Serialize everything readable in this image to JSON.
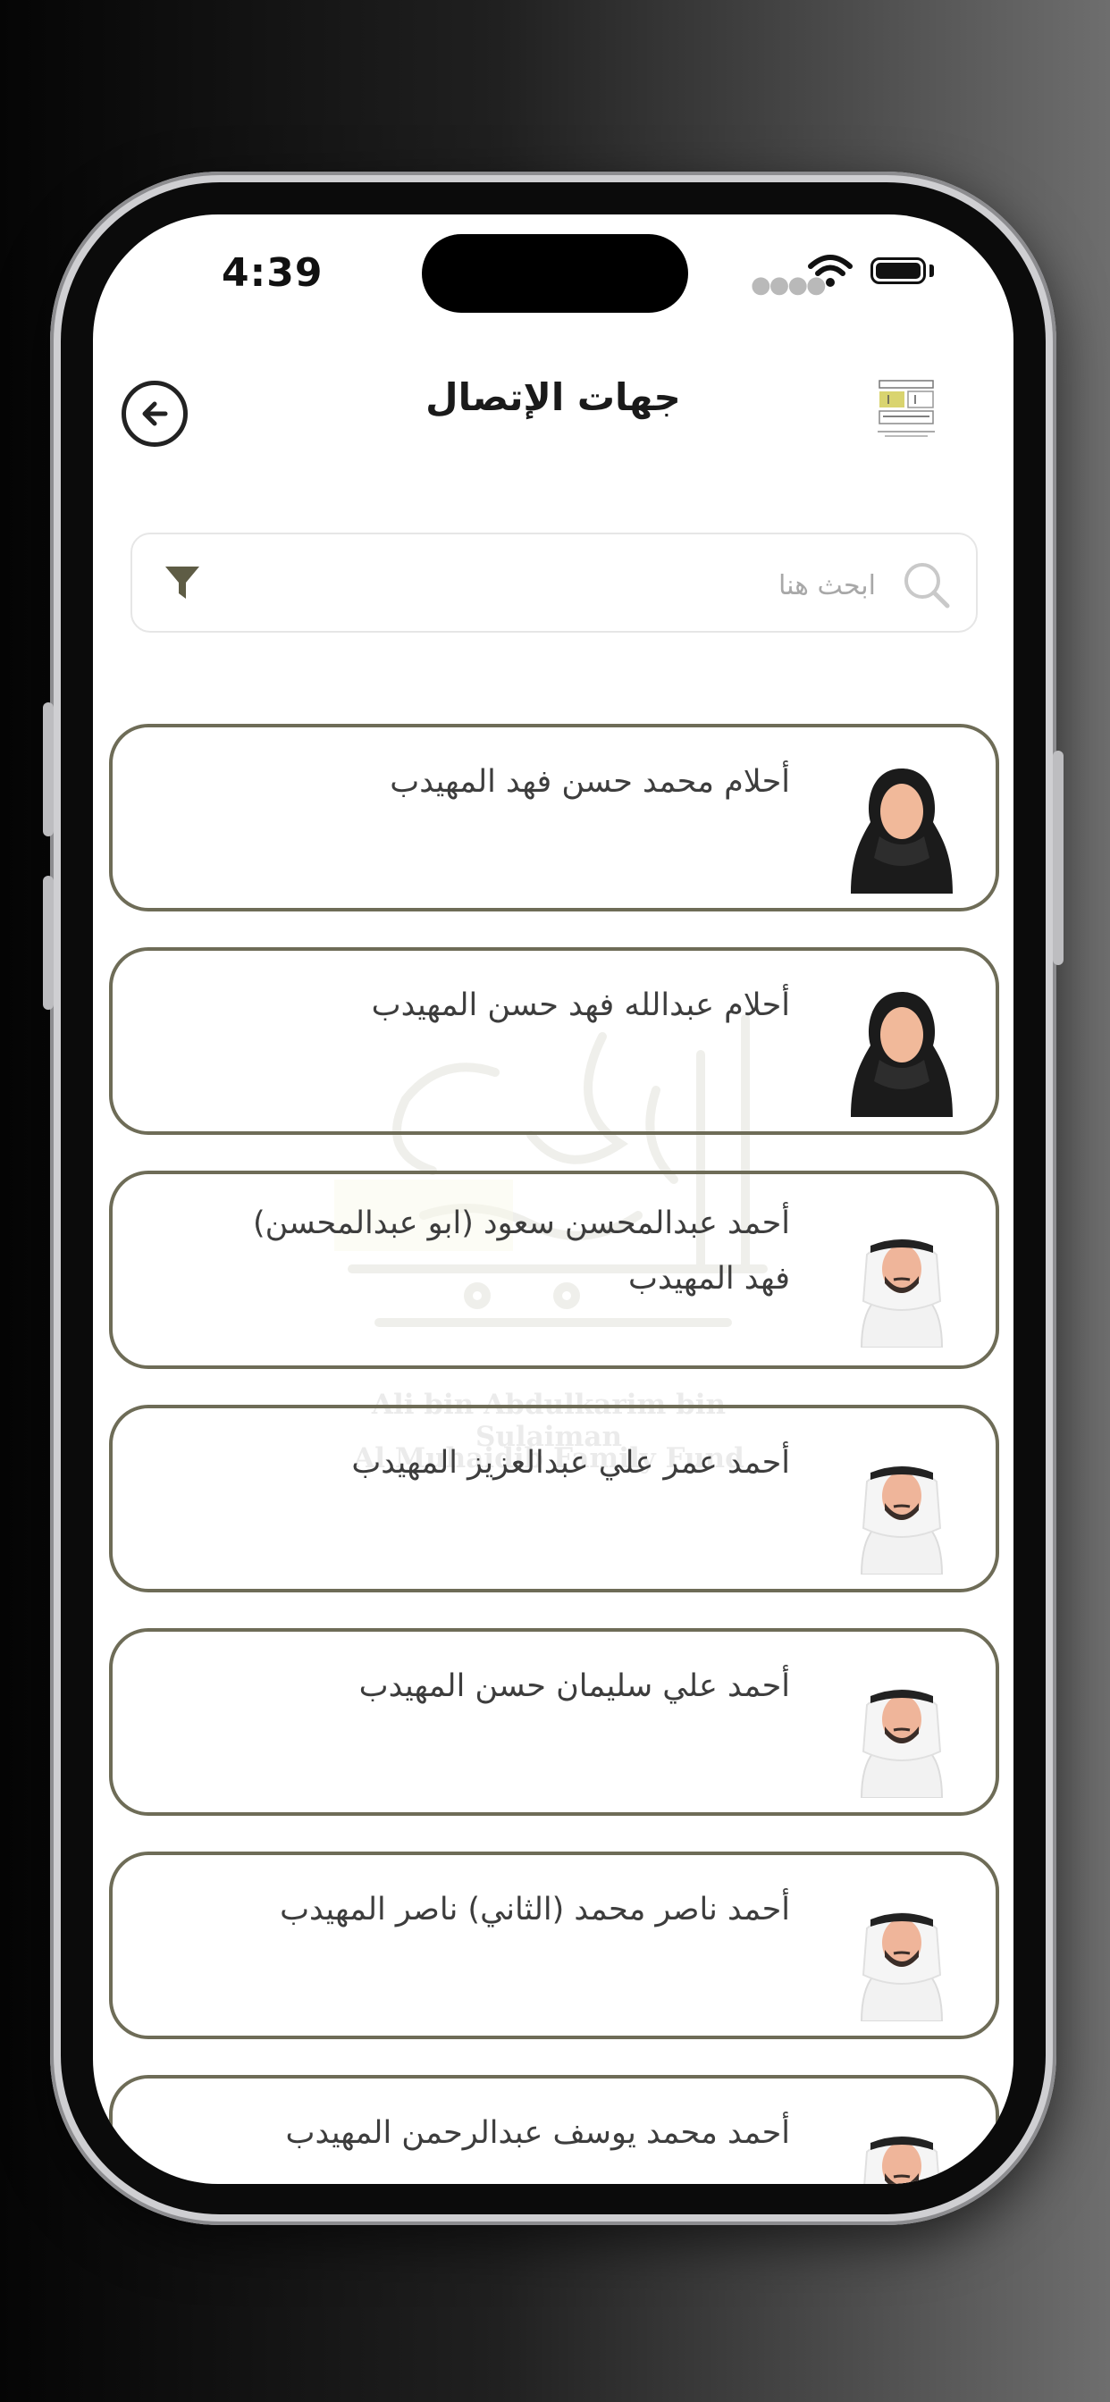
{
  "status_bar": {
    "time": "4:39"
  },
  "header": {
    "title": "جهات الإتصال"
  },
  "search": {
    "placeholder": "ابحث هنا",
    "value": ""
  },
  "watermark": {
    "line1": "Ali bin Abdulkarim bin Sulaiman",
    "line2": "Al Muhaidib Family Fund"
  },
  "contacts": [
    {
      "name": "أحلام محمد حسن فهد المهيدب",
      "gender": "female"
    },
    {
      "name": "أحلام عبدالله فهد حسن المهيدب",
      "gender": "female"
    },
    {
      "name": "أحمد عبدالمحسن سعود (ابو عبدالمحسن) فهد المهيدب",
      "gender": "male"
    },
    {
      "name": "أحمد عمر علي عبدالعزيز المهيدب",
      "gender": "male"
    },
    {
      "name": "أحمد علي سليمان حسن المهيدب",
      "gender": "male"
    },
    {
      "name": "أحمد ناصر محمد (الثاني) ناصر المهيدب",
      "gender": "male"
    },
    {
      "name": "أحمد محمد يوسف عبدالرحمن المهيدب",
      "gender": "male"
    }
  ],
  "colors": {
    "card_border": "#6e6c57",
    "filter_icon": "#5e5c45"
  }
}
